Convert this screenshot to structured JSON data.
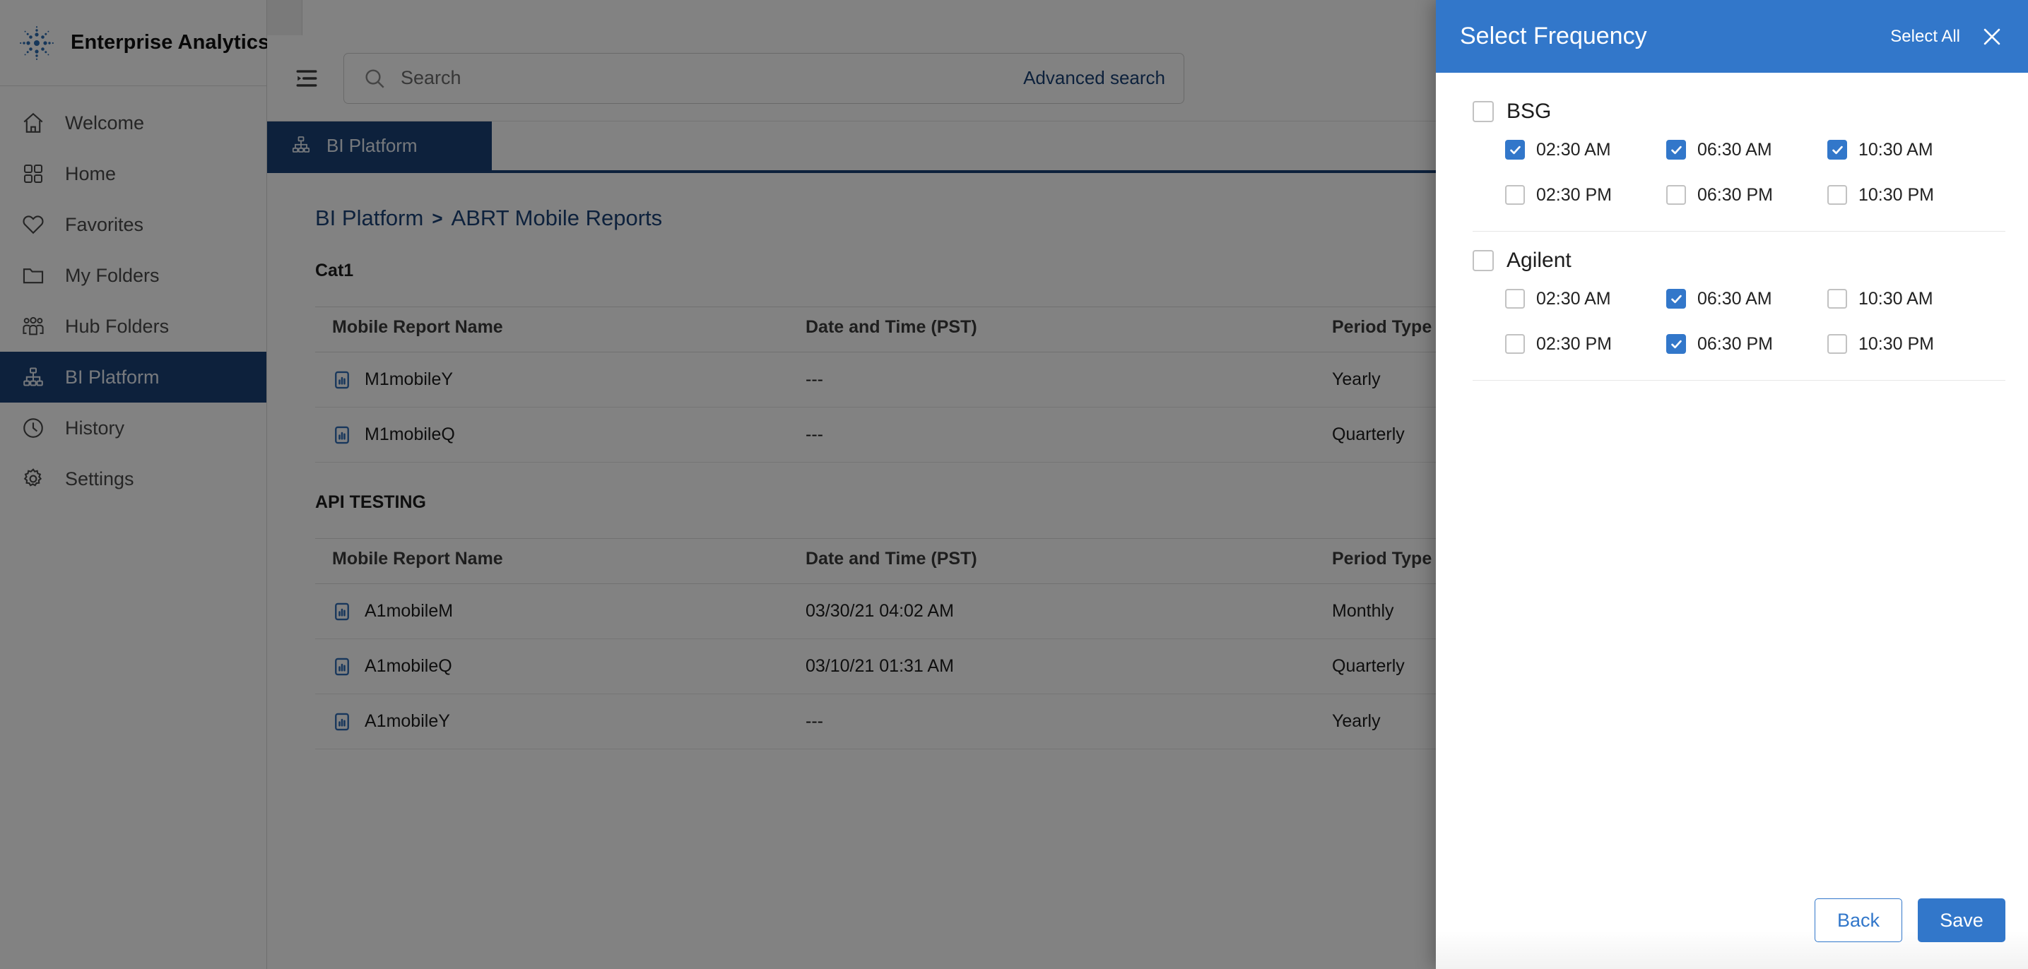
{
  "brand": {
    "title": "Enterprise Analytics",
    "logo_icon": "asterisk-starburst-logo"
  },
  "sidebar": {
    "items": [
      {
        "label": "Welcome",
        "icon": "home-outline-icon",
        "active": false
      },
      {
        "label": "Home",
        "icon": "grid-squares-icon",
        "active": false
      },
      {
        "label": "Favorites",
        "icon": "heart-icon",
        "active": false
      },
      {
        "label": "My Folders",
        "icon": "folder-icon",
        "active": false
      },
      {
        "label": "Hub Folders",
        "icon": "people-group-icon",
        "active": false
      },
      {
        "label": "BI Platform",
        "icon": "org-chart-icon",
        "active": true
      },
      {
        "label": "History",
        "icon": "clock-icon",
        "active": false
      },
      {
        "label": "Settings",
        "icon": "gear-icon",
        "active": false
      }
    ]
  },
  "toolbar": {
    "menu_icon": "list-indent-icon",
    "search_icon": "search-icon",
    "search_value": "",
    "search_placeholder": "Search",
    "advanced_search_label": "Advanced search"
  },
  "tabs": [
    {
      "label": "BI Platform",
      "icon": "org-chart-icon",
      "active": true
    }
  ],
  "breadcrumb": {
    "items": [
      "BI Platform",
      "ABRT Mobile Reports"
    ],
    "separator": ">"
  },
  "content": {
    "columns": [
      "Mobile Report Name",
      "Date and Time (PST)",
      "Period Type"
    ],
    "sections": [
      {
        "title": "Cat1",
        "rows": [
          {
            "name": "M1mobileY",
            "icon": "mobile-report-icon",
            "datetime": "---",
            "period": "Yearly"
          },
          {
            "name": "M1mobileQ",
            "icon": "mobile-report-icon",
            "datetime": "---",
            "period": "Quarterly"
          }
        ]
      },
      {
        "title": "API TESTING",
        "rows": [
          {
            "name": "A1mobileM",
            "icon": "mobile-report-icon",
            "datetime": "03/30/21 04:02 AM",
            "period": "Monthly"
          },
          {
            "name": "A1mobileQ",
            "icon": "mobile-report-icon",
            "datetime": "03/10/21 01:31 AM",
            "period": "Quarterly"
          },
          {
            "name": "A1mobileY",
            "icon": "mobile-report-icon",
            "datetime": "---",
            "period": "Yearly"
          }
        ]
      }
    ]
  },
  "modal": {
    "title": "Select Frequency",
    "select_all_label": "Select All",
    "close_icon": "close-icon",
    "groups": [
      {
        "name": "BSG",
        "checked": false,
        "times": [
          {
            "label": "02:30 AM",
            "checked": true
          },
          {
            "label": "06:30 AM",
            "checked": true
          },
          {
            "label": "10:30 AM",
            "checked": true
          },
          {
            "label": "02:30 PM",
            "checked": false
          },
          {
            "label": "06:30 PM",
            "checked": false
          },
          {
            "label": "10:30 PM",
            "checked": false
          }
        ]
      },
      {
        "name": "Agilent",
        "checked": false,
        "times": [
          {
            "label": "02:30 AM",
            "checked": false
          },
          {
            "label": "06:30 AM",
            "checked": true
          },
          {
            "label": "10:30 AM",
            "checked": false
          },
          {
            "label": "02:30 PM",
            "checked": false
          },
          {
            "label": "06:30 PM",
            "checked": true
          },
          {
            "label": "10:30 PM",
            "checked": false
          }
        ]
      }
    ],
    "back_label": "Back",
    "save_label": "Save"
  },
  "colors": {
    "brand_navy": "#1a4276",
    "accent_blue": "#3277ca",
    "link_blue": "#1a4276",
    "checkbox_checked": "#3277ca"
  }
}
